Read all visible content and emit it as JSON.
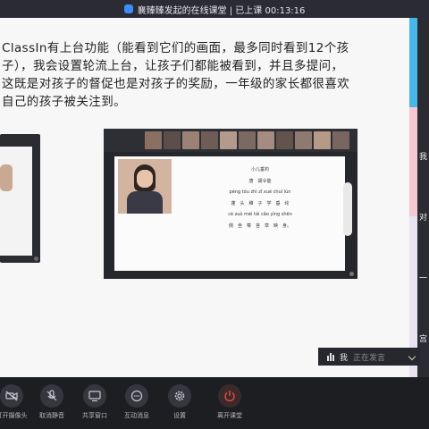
{
  "window": {
    "title": "襄臻臻发起的在线课堂 | 已上课 00:13:16"
  },
  "slide": {
    "lines": [
      "ClassIn有上台功能（能看到它们的画面，最多同时看到12个孩",
      "子），我会设置轮流上台，让孩子们都能被看到，并且多提问，",
      "这既是对孩子的督促也是对孩子的奖励，一年级的家长都很喜欢",
      "自己的孩子被关注到。"
    ]
  },
  "poem": {
    "title": "小儿垂钓",
    "author": "唐　胡令能",
    "pinyin1": "péng tóu zhì zǐ xué chuí lún",
    "line1": "蓬　头　稚　子　学　垂　纶",
    "pinyin2": "cè zuò méi tái cǎo yìng shēn",
    "line2": "侧　坐　莓　苔　草　映　身。"
  },
  "edge_labels": [
    "我",
    "对",
    "一",
    "宫"
  ],
  "voice": {
    "speaker": "我",
    "status": "正在发言"
  },
  "toolbar": {
    "camera": "打开摄像头",
    "mute": "取消静音",
    "share": "共享窗口",
    "chat": "互动消息",
    "settings": "设置",
    "leave": "离开课堂"
  },
  "colors": {
    "accent": "#3b8cff",
    "leave": "#e0473c"
  }
}
